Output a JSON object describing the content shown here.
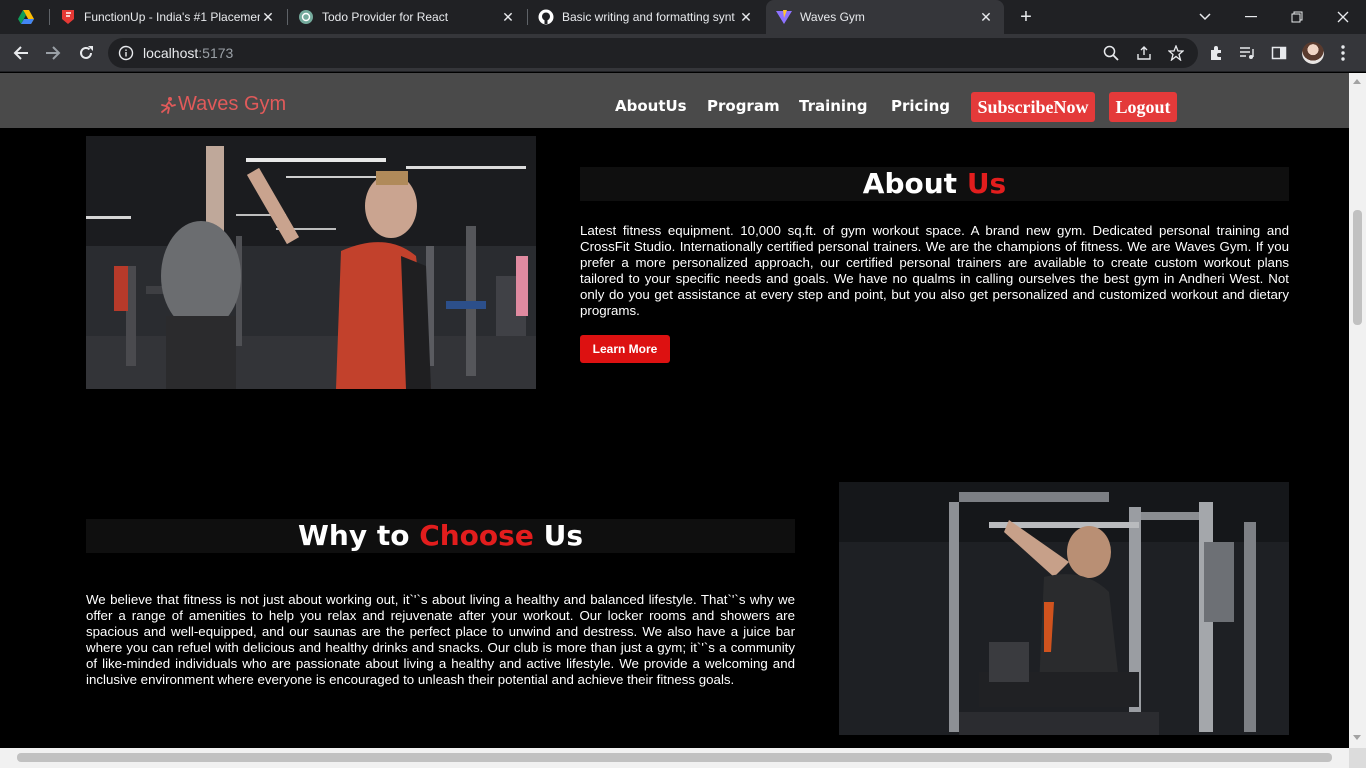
{
  "browser": {
    "tabs": [
      {
        "title": "",
        "icon": "google-drive-icon"
      },
      {
        "title": "FunctionUp - India's #1 Placemen",
        "icon": "functionup-icon"
      },
      {
        "title": "Todo Provider for React",
        "icon": "chatgpt-icon"
      },
      {
        "title": "Basic writing and formatting synt",
        "icon": "github-icon"
      },
      {
        "title": "Waves Gym",
        "icon": "vite-icon",
        "active": true
      }
    ],
    "url_host": "localhost",
    "url_port": ":5173"
  },
  "site": {
    "brand": "Waves Gym",
    "nav": [
      "AboutUs",
      "Program",
      "Training",
      "Pricing"
    ],
    "subscribe_label": "SubscribeNow",
    "logout_label": "Logout"
  },
  "about": {
    "title_white": "About",
    "title_red": "Us",
    "text": "Latest fitness equipment. 10,000 sq.ft. of gym workout space. A brand new gym. Dedicated personal training and CrossFit Studio. Internationally certified personal trainers. We are the champions of fitness. We are Waves Gym. If you prefer a more personalized approach, our certified personal trainers are available to create custom workout plans tailored to your specific needs and goals. We have no qualms in calling ourselves the best gym in Andheri West. Not only do you get assistance at every step and point, but you also get personalized and customized workout and dietary programs.",
    "button_label": "Learn More"
  },
  "why": {
    "title_white_1": "Why to",
    "title_red": "Choose",
    "title_white_2": "Us",
    "text": "We believe that fitness is not just about working out, it`'`s about living a healthy and balanced lifestyle. That`'`s why we offer a range of amenities to help you relax and rejuvenate after your workout. Our locker rooms and showers are spacious and well-equipped, and our saunas are the perfect place to unwind and destress. We also have a juice bar where you can refuel with delicious and healthy drinks and snacks. Our club is more than just a gym; it`'`s a community of like-minded individuals who are passionate about living a healthy and active lifestyle. We provide a welcoming and inclusive environment where everyone is encouraged to unleash their potential and achieve their fitness goals."
  },
  "colors": {
    "accent_red": "#e21d1d",
    "brand_red": "#e15a5a",
    "nav_bg": "#4a4a4a"
  }
}
